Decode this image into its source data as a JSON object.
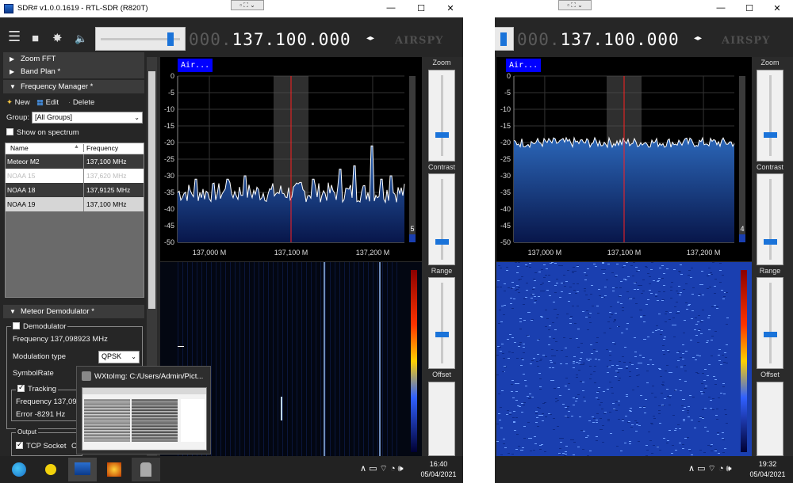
{
  "window": {
    "title": "SDR# v1.0.0.1619 - RTL-SDR (R820T)",
    "minimize": "—",
    "maximize": "☐",
    "close": "✕"
  },
  "grip": {
    "label": "▫ ⛶ ⌄"
  },
  "toolbar": {
    "menu_icon": "☰",
    "stop_icon": "■",
    "settings_icon": "✸",
    "volume_icon": "🔈",
    "frequency_dim": "000.",
    "frequency": "137.100.000",
    "tune_arrows": "◂▸",
    "logo": "AIRSPY"
  },
  "sidebar": {
    "zoom_fft": "Zoom FFT",
    "band_plan": "Band Plan *",
    "freq_manager": "Frequency Manager *",
    "new_label": "New",
    "edit_label": "Edit",
    "delete_label": "Delete",
    "group_label": "Group:",
    "group_value": "[All Groups]",
    "show_spectrum": "Show on spectrum",
    "columns": {
      "name": "Name",
      "frequency": "Frequency"
    },
    "rows": [
      {
        "name": "Meteor M2",
        "frequency": "137,100 MHz"
      },
      {
        "name": "NOAA 15",
        "frequency": "137,620 MHz"
      },
      {
        "name": "NOAA 18",
        "frequency": "137,9125 MHz"
      },
      {
        "name": "NOAA 19",
        "frequency": "137,100 MHz"
      }
    ],
    "meteor_demod": "Meteor Demodulator *",
    "demodulator": "Demodulator",
    "demod_freq": "Frequency 137,098923 MHz",
    "mod_type_label": "Modulation type",
    "mod_type_value": "QPSK",
    "symbolrate_label": "SymbolRate",
    "tracking": "Tracking",
    "track_freq": "Frequency 137,097",
    "track_error": "Error -8291 Hz",
    "output": "Output",
    "tcp_socket": "TCP Socket",
    "tcp_extra": "C"
  },
  "spectrum": {
    "badge": "Air...",
    "y_ticks": [
      "0",
      "-5",
      "-10",
      "-15",
      "-20",
      "-25",
      "-30",
      "-35",
      "-40",
      "-45",
      "-50"
    ],
    "x_ticks": [
      "137,000 M",
      "137,100 M",
      "137,200 M"
    ],
    "left_level": "5",
    "right_level": "4"
  },
  "controls": {
    "zoom": "Zoom",
    "contrast": "Contrast",
    "range": "Range",
    "offset": "Offset"
  },
  "popup": {
    "title": "WXtoImg: C:/Users/Admin/Pict..."
  },
  "taskbar": {
    "left_time": "16:40",
    "left_date": "05/04/2021",
    "right_time": "19:32",
    "right_date": "05/04/2021",
    "tray_icons": "∧ ▭ ⌔ ◔ 🕪"
  },
  "colors": {
    "accent": "#1a73d9",
    "badge": "#0000ff",
    "spectrum_fill": "#0a2a66",
    "trace": "#ffffff",
    "center_line": "#ff2020"
  }
}
